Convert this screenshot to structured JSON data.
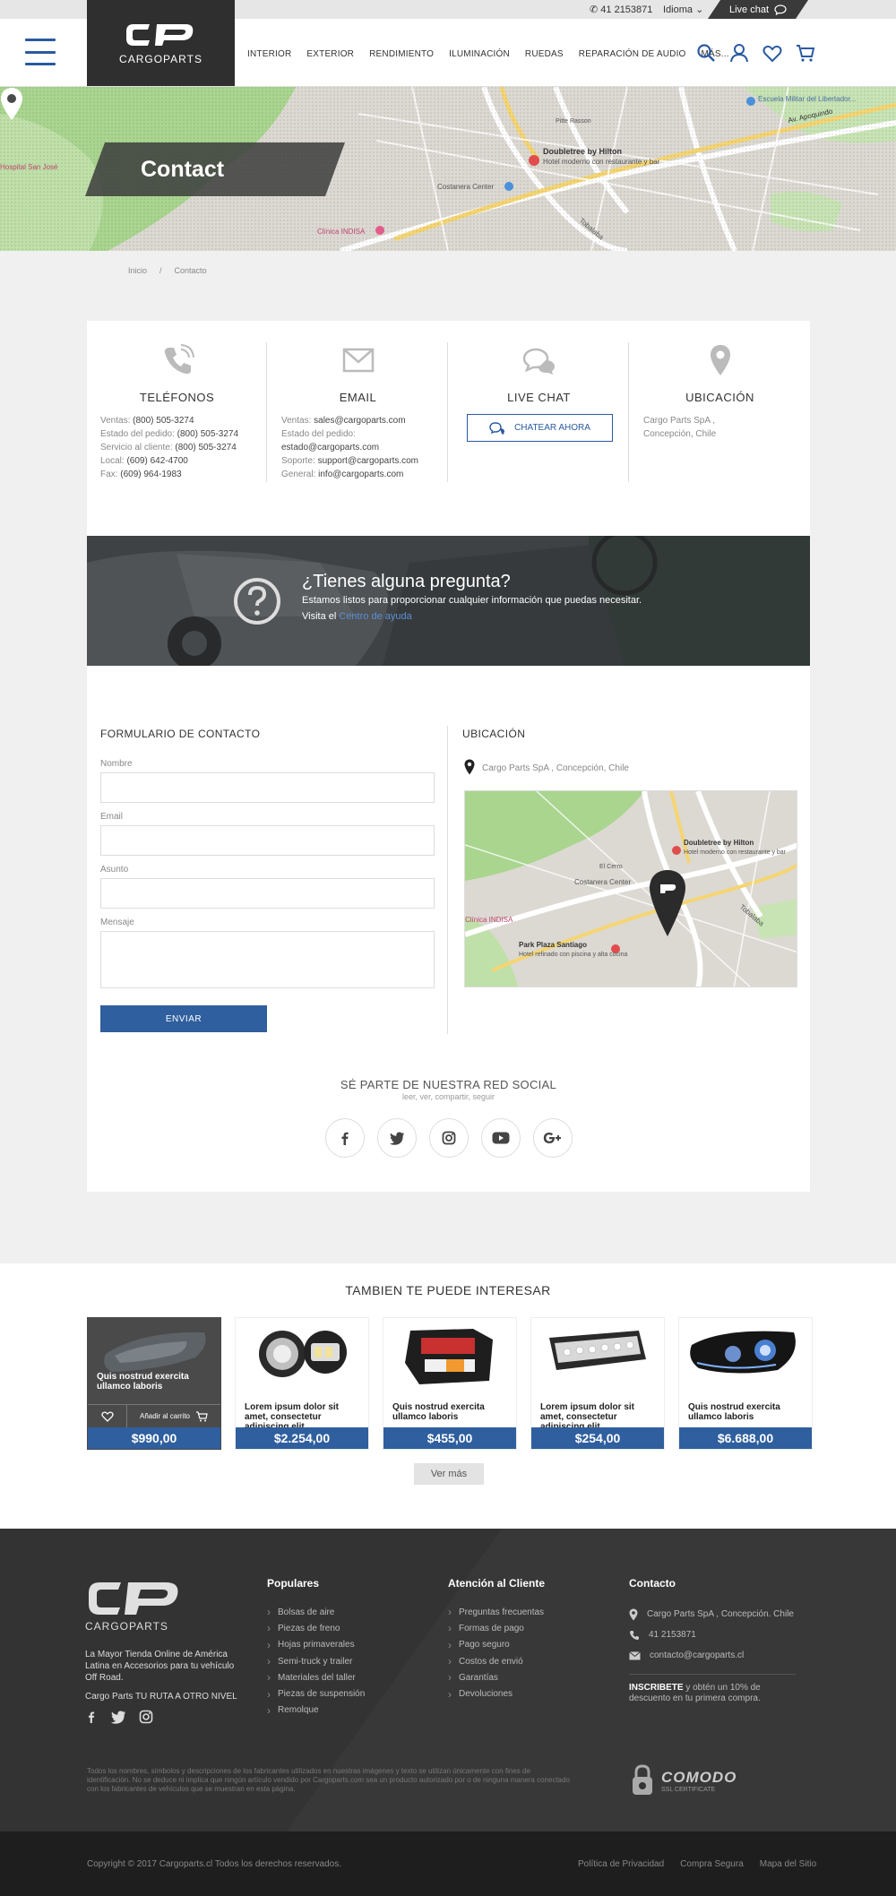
{
  "topbar": {
    "phone": "41 2153871",
    "language": "Idioma",
    "live_chat": "Live chat"
  },
  "header": {
    "logo_text": "CARGOPARTS",
    "nav": [
      "INTERIOR",
      "EXTERIOR",
      "RENDIMIENTO",
      "ILUMINACIÓN",
      "RUEDAS",
      "REPARACIÓN DE AUDIO",
      "MÁS..."
    ],
    "icons": [
      "search-icon",
      "user-icon",
      "heart-icon",
      "cart-icon"
    ]
  },
  "hero": {
    "title": "Contact",
    "map_labels": [
      "Doubletree by Hilton",
      "Hotel moderno con restaurante y bar",
      "Costanera Center",
      "Av. Apoquindo",
      "Clínica INDISA",
      "Escuela Militar del Libertador...",
      "Hospital San José",
      "Pitte Rasson",
      "Tobalaba"
    ]
  },
  "breadcrumb": [
    "Inicio",
    "Contacto"
  ],
  "contact": {
    "phones": {
      "title": "TELÉFONOS",
      "lines": [
        {
          "label": "Ventas: ",
          "value": "(800) 505-3274"
        },
        {
          "label": "Estado del pedido: ",
          "value": "(800) 505-3274"
        },
        {
          "label": "Servicio al cliente: ",
          "value": "(800) 505-3274"
        },
        {
          "label": "Local: ",
          "value": "(609) 642-4700"
        },
        {
          "label": "Fax: ",
          "value": "(609) 964-1983"
        }
      ]
    },
    "email": {
      "title": "EMAIL",
      "lines": [
        {
          "label": "Ventas: ",
          "value": "sales@cargoparts.com"
        },
        {
          "label": "Estado del pedido:",
          "value": ""
        },
        {
          "label": "",
          "value": "estado@cargoparts.com"
        },
        {
          "label": "Soporte: ",
          "value": "support@cargoparts.com"
        },
        {
          "label": "General: ",
          "value": "info@cargoparts.com"
        }
      ]
    },
    "chat": {
      "title": "LIVE CHAT",
      "button": "CHATEAR AHORA"
    },
    "location": {
      "title": "UBICACIÓN",
      "line1": "Cargo Parts SpA ,",
      "line2": "Concepción, Chile"
    }
  },
  "question": {
    "title": "¿Tienes alguna pregunta?",
    "subtitle": "Estamos listos para proporcionar cualquier información que puedas necesitar.",
    "visit": "Visita el ",
    "link": "Centro de ayuda"
  },
  "form": {
    "title": "FORMULARIO DE CONTACTO",
    "fields": [
      "Nombre",
      "Email",
      "Asunto",
      "Mensaje"
    ],
    "submit": "ENVIAR"
  },
  "map_section": {
    "title": "UBICACIÓN",
    "address": "Cargo Parts SpA , Concepción, Chile",
    "map_labels": [
      "Doubletree by Hilton",
      "Hotel moderno con restaurante y bar",
      "Costanera Center",
      "Park Plaza Santiago",
      "Hotel refinado con piscina y alta cocina",
      "Clínica INDISA",
      "Tobalaba",
      "El Cerro"
    ]
  },
  "social": {
    "title": "SÉ PARTE DE NUESTRA RED SOCIAL",
    "subtitle": "leer, ver, compartir, seguir",
    "icons": [
      "facebook-icon",
      "twitter-icon",
      "instagram-icon",
      "youtube-icon",
      "google-plus-icon"
    ]
  },
  "products": {
    "title": "TAMBIEN TE PUEDE INTERESAR",
    "add_to_cart": "Añadir al carrito",
    "items": [
      {
        "name": "Quis nostrud exercita ullamco laboris",
        "price": "$990,00"
      },
      {
        "name": "Lorem ipsum dolor sit amet, consectetur adipiscing elit",
        "price": "$2.254,00"
      },
      {
        "name": "Quis nostrud exercita ullamco laboris",
        "price": "$455,00"
      },
      {
        "name": "Lorem ipsum dolor sit amet, consectetur adipiscing elit",
        "price": "$254,00"
      },
      {
        "name": "Quis nostrud exercita ullamco laboris",
        "price": "$6.688,00"
      }
    ],
    "more": "Ver más"
  },
  "footer": {
    "logo_text": "CARGOPARTS",
    "description": "La Mayor Tienda Online de América Latina en Accesorios para tu vehículo Off Road.",
    "slogan": "Cargo Parts TU RUTA A OTRO NIVEL",
    "popular": {
      "title": "Populares",
      "items": [
        "Bolsas de aire",
        "Piezas de freno",
        "Hojas primaverales",
        "Semi-truck y trailer",
        "Materiales del taller",
        "Piezas de suspensión",
        "Remolque"
      ]
    },
    "service": {
      "title": "Atención al Cliente",
      "items": [
        "Preguntas frecuentas",
        "Formas de pago",
        "Pago seguro",
        "Costos de envió",
        "Garantías",
        "Devoluciones"
      ]
    },
    "contact": {
      "title": "Contacto",
      "address": "Cargo Parts SpA , Concepción. Chile",
      "phone": "41 2153871",
      "email": "contacto@cargoparts.cl"
    },
    "subscribe_bold": "INSCRIBETE",
    "subscribe_text": " y obtén un 10% de descuento en tu primera compra.",
    "legal": "Todos los nombres, símbolos y descripciones de los fabricantes utilizados en nuestras imágenes y texto se utilizan únicamente con fines de identificación. No se deduce ni implica que ningún artículo vendido por Cargoparts.com sea un producto autorizado por o de ninguna manera conectado con los fabricantes de vehículos que se muestran en esta página.",
    "ssl_brand": "COMODO",
    "ssl_sub": "SSL CERTIFICATE"
  },
  "bottom": {
    "copyright": "Copyright © 2017 Cargoparts.cl   Todos los derechos reservados.",
    "links": [
      "Política de Privacidad",
      "Compra Segura",
      "Mapa del Sitio"
    ]
  },
  "colors": {
    "accent": "#2f5f9e",
    "dark": "#2f2f2f",
    "footer": "#333333"
  }
}
